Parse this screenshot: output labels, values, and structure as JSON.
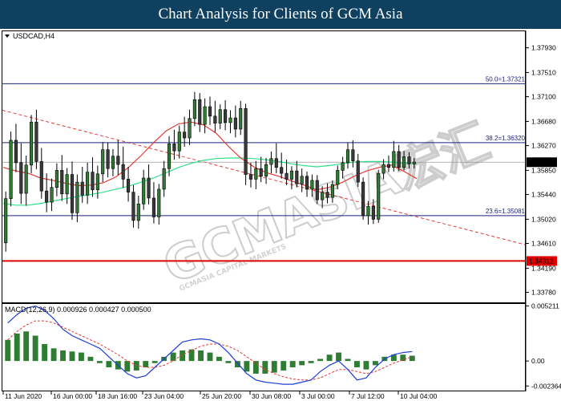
{
  "header": {
    "title": "Chart Analysis for Clients of GCM Asia"
  },
  "colors": {
    "header_bg": "#0f4060",
    "bull": "#2e7d32",
    "bear": "#3a3a3a",
    "ma_fast": "#e53935",
    "ma_slow": "#2ee08a",
    "fib": "#1a237e",
    "support": "#e00000",
    "trend": "#e53935",
    "macd_line": "#1e3fd8",
    "signal_line": "#e53935",
    "hist": "#2e7d32",
    "price_box": "#000000"
  },
  "watermark": {
    "text": "GCMASIA宏汇",
    "sub": "GCMASIA CAPITAL MARKETS"
  },
  "chart_data": [
    {
      "type": "candlestick",
      "symbol_label": "USDCAD,H4",
      "ylim": [
        1.3361,
        1.3821
      ],
      "y_ticks": [
        "1.37930",
        "1.37510",
        "1.37100",
        "1.36680",
        "1.36270",
        "1.35850",
        "1.35440",
        "1.35020",
        "1.34610",
        "1.34190",
        "1.33780"
      ],
      "current_price": "1.35988",
      "levels": [
        {
          "label": "50.0=1.37321",
          "value": 1.37321,
          "kind": "fib"
        },
        {
          "label": "38.2=1.36320",
          "value": 1.3632,
          "kind": "fib"
        },
        {
          "label": "23.6=1.35081",
          "value": 1.35081,
          "kind": "fib"
        },
        {
          "label": "1.34312",
          "value": 1.34312,
          "kind": "support"
        }
      ],
      "trendline": {
        "style": "dashed",
        "from_value": 1.3687,
        "to_value": 1.3459
      },
      "x_labels": [
        "11 Jun 2020",
        "16 Jun 00:00",
        "18 Jun 16:00",
        "23 Jun 04:00",
        "25 Jun 20:00",
        "30 Jun 08:00",
        "3 Jul 00:00",
        "7 Jul 12:00",
        "10 Jul 04:00"
      ],
      "candles": [
        [
          1.3462,
          1.3549,
          1.3447,
          1.3537
        ],
        [
          1.3537,
          1.3651,
          1.3524,
          1.3636
        ],
        [
          1.3636,
          1.3664,
          1.3582,
          1.3598
        ],
        [
          1.3598,
          1.3631,
          1.3528,
          1.3546
        ],
        [
          1.3546,
          1.361,
          1.3525,
          1.3594
        ],
        [
          1.3594,
          1.3679,
          1.358,
          1.3667
        ],
        [
          1.3667,
          1.3688,
          1.3587,
          1.36
        ],
        [
          1.36,
          1.3623,
          1.3537,
          1.355
        ],
        [
          1.355,
          1.358,
          1.3514,
          1.3531
        ],
        [
          1.3531,
          1.3571,
          1.3516,
          1.3556
        ],
        [
          1.3556,
          1.3597,
          1.3541,
          1.3585
        ],
        [
          1.3585,
          1.3611,
          1.3533,
          1.3545
        ],
        [
          1.3545,
          1.3589,
          1.3528,
          1.3578
        ],
        [
          1.3578,
          1.36,
          1.3501,
          1.3513
        ],
        [
          1.3513,
          1.3578,
          1.3497,
          1.3565
        ],
        [
          1.3565,
          1.3591,
          1.353,
          1.3543
        ],
        [
          1.3543,
          1.3598,
          1.3528,
          1.3582
        ],
        [
          1.3582,
          1.3607,
          1.354,
          1.3552
        ],
        [
          1.3552,
          1.3593,
          1.3537,
          1.3579
        ],
        [
          1.3579,
          1.3633,
          1.3565,
          1.362
        ],
        [
          1.362,
          1.3632,
          1.3573,
          1.3588
        ],
        [
          1.3588,
          1.3621,
          1.3575,
          1.3609
        ],
        [
          1.3609,
          1.3636,
          1.3577,
          1.3595
        ],
        [
          1.3595,
          1.3625,
          1.3555,
          1.357
        ],
        [
          1.357,
          1.3591,
          1.3532,
          1.3548
        ],
        [
          1.3548,
          1.356,
          1.3488,
          1.35
        ],
        [
          1.35,
          1.3542,
          1.3486,
          1.3528
        ],
        [
          1.3528,
          1.3586,
          1.3518,
          1.3572
        ],
        [
          1.3572,
          1.3595,
          1.3527,
          1.3538
        ],
        [
          1.3538,
          1.3565,
          1.3495,
          1.3506
        ],
        [
          1.3506,
          1.3562,
          1.3493,
          1.3553
        ],
        [
          1.3553,
          1.3601,
          1.354,
          1.3588
        ],
        [
          1.3588,
          1.3643,
          1.3575,
          1.363
        ],
        [
          1.363,
          1.3654,
          1.3603,
          1.3618
        ],
        [
          1.3618,
          1.3661,
          1.3605,
          1.365
        ],
        [
          1.365,
          1.3676,
          1.3625,
          1.364
        ],
        [
          1.364,
          1.3688,
          1.3628,
          1.3673
        ],
        [
          1.3673,
          1.3718,
          1.366,
          1.3705
        ],
        [
          1.3705,
          1.3716,
          1.365,
          1.3663
        ],
        [
          1.3663,
          1.3707,
          1.3648,
          1.3693
        ],
        [
          1.3693,
          1.371,
          1.3662,
          1.3677
        ],
        [
          1.3677,
          1.3703,
          1.365,
          1.3665
        ],
        [
          1.3665,
          1.3697,
          1.3655,
          1.3688
        ],
        [
          1.3688,
          1.3704,
          1.3653,
          1.3666
        ],
        [
          1.3666,
          1.3687,
          1.3648,
          1.3674
        ],
        [
          1.3674,
          1.3695,
          1.3641,
          1.3655
        ],
        [
          1.3655,
          1.3703,
          1.3645,
          1.369
        ],
        [
          1.369,
          1.3698,
          1.356,
          1.3578
        ],
        [
          1.3578,
          1.3598,
          1.3556,
          1.357
        ],
        [
          1.357,
          1.3601,
          1.3553,
          1.3588
        ],
        [
          1.3588,
          1.3608,
          1.3565,
          1.3575
        ],
        [
          1.3575,
          1.3606,
          1.3562,
          1.3595
        ],
        [
          1.3595,
          1.3617,
          1.358,
          1.3605
        ],
        [
          1.3605,
          1.3631,
          1.358,
          1.359
        ],
        [
          1.359,
          1.3615,
          1.3571,
          1.358
        ],
        [
          1.358,
          1.3603,
          1.356,
          1.357
        ],
        [
          1.357,
          1.3592,
          1.3553,
          1.3584
        ],
        [
          1.3584,
          1.3601,
          1.3556,
          1.3562
        ],
        [
          1.3562,
          1.3588,
          1.3548,
          1.3575
        ],
        [
          1.3575,
          1.3583,
          1.354,
          1.3553
        ],
        [
          1.3553,
          1.3578,
          1.354,
          1.3568
        ],
        [
          1.3568,
          1.3577,
          1.3528,
          1.3535
        ],
        [
          1.3535,
          1.3558,
          1.3521,
          1.3548
        ],
        [
          1.3548,
          1.3563,
          1.3529,
          1.3539
        ],
        [
          1.3539,
          1.3568,
          1.353,
          1.3561
        ],
        [
          1.3561,
          1.3593,
          1.3553,
          1.3585
        ],
        [
          1.3585,
          1.3608,
          1.3571,
          1.3598
        ],
        [
          1.3598,
          1.3632,
          1.3588,
          1.362
        ],
        [
          1.362,
          1.3636,
          1.359,
          1.3601
        ],
        [
          1.3601,
          1.3613,
          1.3557,
          1.3565
        ],
        [
          1.3565,
          1.3573,
          1.3501,
          1.3508
        ],
        [
          1.3508,
          1.3533,
          1.3493,
          1.3524
        ],
        [
          1.3524,
          1.3536,
          1.3494,
          1.3502
        ],
        [
          1.3502,
          1.3586,
          1.3496,
          1.358
        ],
        [
          1.358,
          1.3604,
          1.357,
          1.3595
        ],
        [
          1.3595,
          1.361,
          1.3582,
          1.359
        ],
        [
          1.359,
          1.3635,
          1.3583,
          1.3617
        ],
        [
          1.3617,
          1.3628,
          1.3584,
          1.359
        ],
        [
          1.359,
          1.3618,
          1.3585,
          1.3608
        ],
        [
          1.3608,
          1.3616,
          1.3588,
          1.3596
        ],
        [
          1.3596,
          1.3606,
          1.3588,
          1.3599
        ]
      ],
      "ma_fast": [
        1.359,
        1.3584,
        1.358,
        1.3572,
        1.3568,
        1.3563,
        1.3559,
        1.356,
        1.3564,
        1.3574,
        1.359,
        1.361,
        1.3632,
        1.3652,
        1.3664,
        1.3667,
        1.3662,
        1.3648,
        1.3625,
        1.3605,
        1.3591,
        1.3581,
        1.3575,
        1.3567,
        1.356,
        1.3552,
        1.3556,
        1.3564,
        1.3575,
        1.3584,
        1.359,
        1.3594,
        1.3583,
        1.3571
      ],
      "ma_slow": [
        1.3529,
        1.3526,
        1.3526,
        1.3529,
        1.3533,
        1.3537,
        1.3541,
        1.3544,
        1.3548,
        1.3553,
        1.3558,
        1.3565,
        1.3572,
        1.3581,
        1.359,
        1.3597,
        1.3602,
        1.3605,
        1.3606,
        1.3606,
        1.3605,
        1.3603,
        1.36,
        1.3596,
        1.3593,
        1.3591,
        1.3593,
        1.3596,
        1.3599,
        1.36,
        1.36,
        1.3599,
        1.3597,
        1.3596
      ]
    },
    {
      "type": "macd",
      "label": "MACD(12,26,9) 0.000926 0.000427 0.000500",
      "params": "12,26,9",
      "values": {
        "macd": 0.000926,
        "signal": 0.000427,
        "histogram": 0.0005
      },
      "ylim": [
        -0.0028,
        0.0054
      ],
      "y_ticks": [
        "0.005211",
        "0.00",
        "-0.002364"
      ],
      "macd_line": [
        0.0036,
        0.0044,
        0.005,
        0.0052,
        0.0048,
        0.004,
        0.003,
        0.0024,
        0.002,
        0.0016,
        0.0012,
        0.0004,
        -0.0004,
        -0.0012,
        -0.0016,
        -0.0014,
        -0.0006,
        0.0002,
        0.001,
        0.0018,
        0.002,
        0.0021,
        0.002,
        0.0016,
        0.0008,
        -0.0002,
        -0.0012,
        -0.0018,
        -0.002,
        -0.0021,
        -0.0022,
        -0.0022,
        -0.002,
        -0.0018,
        -0.001,
        -0.0004,
        0.0,
        -0.0008,
        -0.0018,
        -0.0016,
        -0.0006,
        0.0002,
        0.0006,
        0.0008,
        0.0009
      ],
      "signal_line": [
        0.002,
        0.0028,
        0.0034,
        0.0038,
        0.0038,
        0.0036,
        0.0032,
        0.0028,
        0.0024,
        0.002,
        0.0016,
        0.0011,
        0.0006,
        0.0,
        -0.0004,
        -0.0006,
        -0.0006,
        -0.0004,
        0.0,
        0.0006,
        0.001,
        0.0014,
        0.0016,
        0.0016,
        0.0014,
        0.001,
        0.0004,
        -0.0002,
        -0.0008,
        -0.0012,
        -0.0015,
        -0.0017,
        -0.0018,
        -0.0018,
        -0.0016,
        -0.0012,
        -0.0008,
        -0.0008,
        -0.001,
        -0.0012,
        -0.001,
        -0.0006,
        -0.0002,
        0.0001,
        0.0004
      ],
      "histogram": [
        0.002,
        0.0026,
        0.0028,
        0.0024,
        0.0016,
        0.0012,
        0.001,
        0.0009,
        0.0008,
        0.0004,
        -0.0002,
        -0.0006,
        -0.0008,
        -0.001,
        -0.0009,
        -0.0006,
        -0.0002,
        0.0004,
        0.0008,
        0.001,
        0.0011,
        0.001,
        0.0008,
        0.0004,
        -0.0002,
        -0.0006,
        -0.001,
        -0.0012,
        -0.0012,
        -0.0011,
        -0.0009,
        -0.0006,
        -0.0004,
        -0.0002,
        0.0002,
        0.0006,
        0.0008,
        0.0002,
        -0.0006,
        -0.0008,
        -0.0004,
        0.0004,
        0.0006,
        0.0006,
        0.0005
      ]
    }
  ]
}
